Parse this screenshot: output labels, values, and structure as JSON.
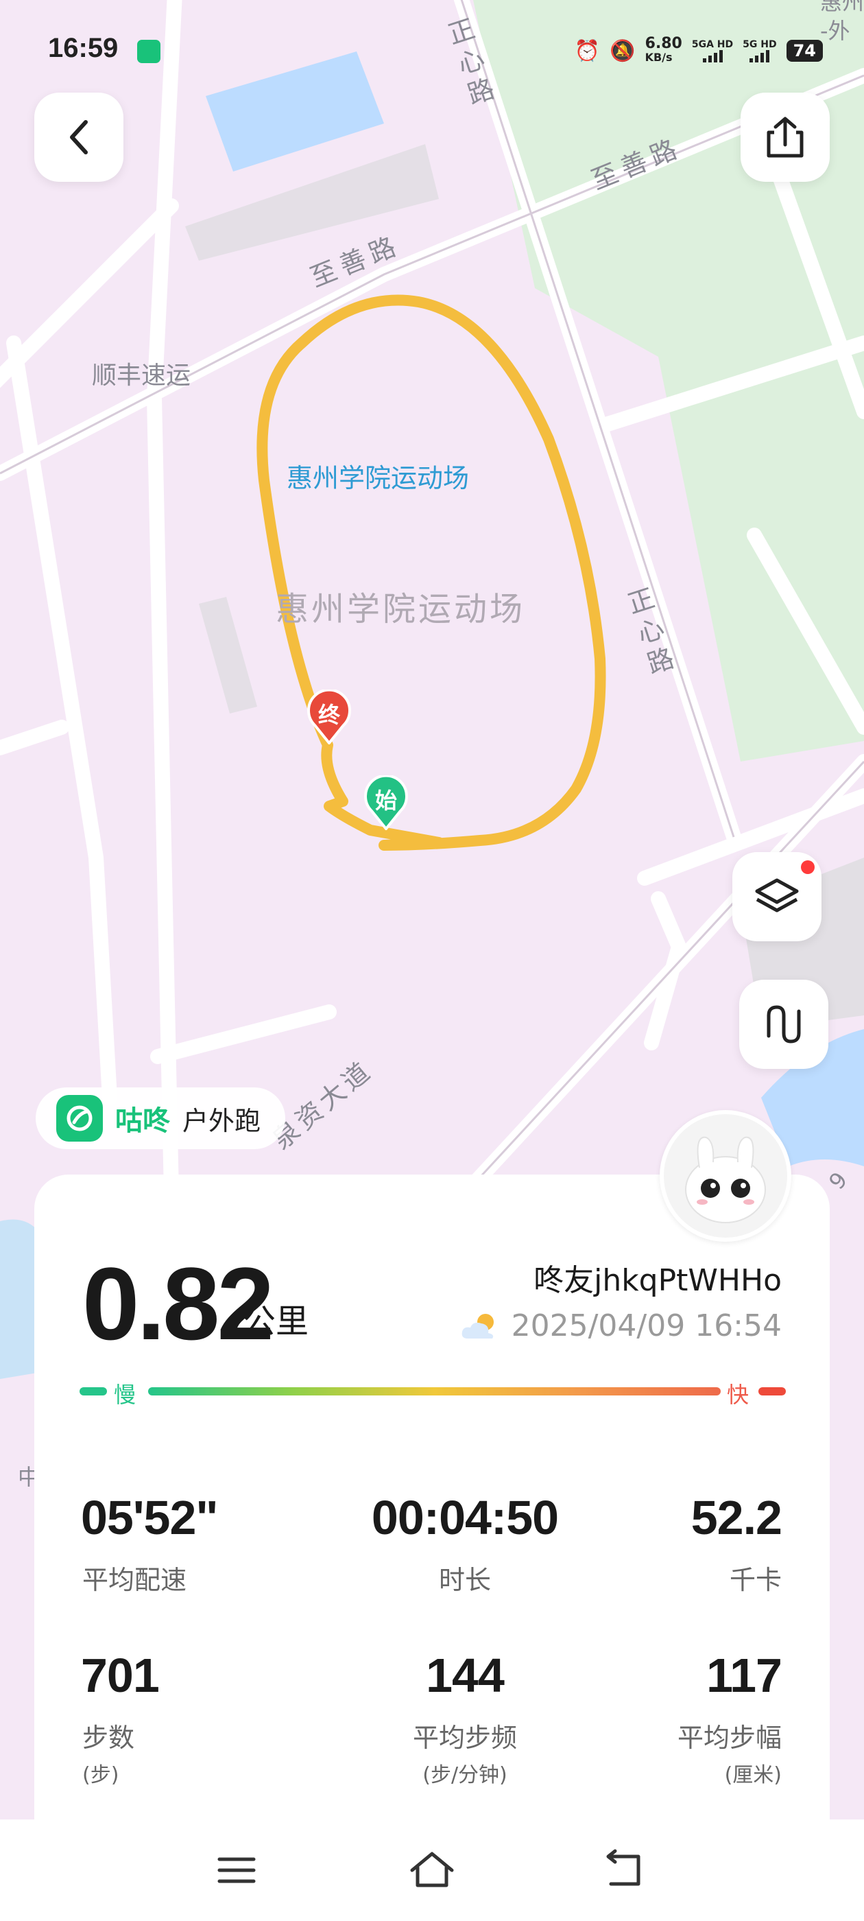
{
  "status_bar": {
    "time": "16:59",
    "net_speed_value": "6.80",
    "net_speed_unit": "KB/s",
    "sim1": "5GA HD",
    "sim2": "5G HD",
    "battery": "74"
  },
  "map": {
    "labels": {
      "road_zhishan_1": "至善路",
      "road_zhishan_2": "至善路",
      "road_zhengxin_1": "正心路",
      "road_zhengxin_2": "正心路",
      "road_dadao": "泉资大道",
      "poi_shunfeng": "顺丰速运",
      "venue_blue": "惠州学院运动场",
      "venue_gray": "惠州学院运动场",
      "corner_top": "惠州",
      "corner_top2": "-外",
      "edge_left": "中",
      "edge_right": "9"
    },
    "start_marker": "始",
    "end_marker": "终"
  },
  "app": {
    "name": "咕咚",
    "activity": "户外跑"
  },
  "summary": {
    "distance": "0.82",
    "distance_unit": "公里",
    "username": "咚友jhkqPtWHHo",
    "datetime": "2025/04/09 16:54",
    "speed_slow": "慢",
    "speed_fast": "快"
  },
  "stats": [
    {
      "value": "05'52\"",
      "label": "平均配速",
      "sub": ""
    },
    {
      "value": "00:04:50",
      "label": "时长",
      "sub": ""
    },
    {
      "value": "52.2",
      "label": "千卡",
      "sub": ""
    },
    {
      "value": "701",
      "label": "步数",
      "sub": "(步)"
    },
    {
      "value": "144",
      "label": "平均步频",
      "sub": "(步/分钟)"
    },
    {
      "value": "117",
      "label": "平均步幅",
      "sub": "(厘米)"
    }
  ],
  "colors": {
    "track": "#f4bd3e",
    "brand": "#19c27a",
    "end_pin": "#e8493a",
    "start_pin": "#23c184"
  },
  "icons": [
    "back-icon",
    "share-icon",
    "layers-icon",
    "route-toggle-icon",
    "menu-icon",
    "home-icon",
    "return-icon",
    "weather-icon"
  ]
}
